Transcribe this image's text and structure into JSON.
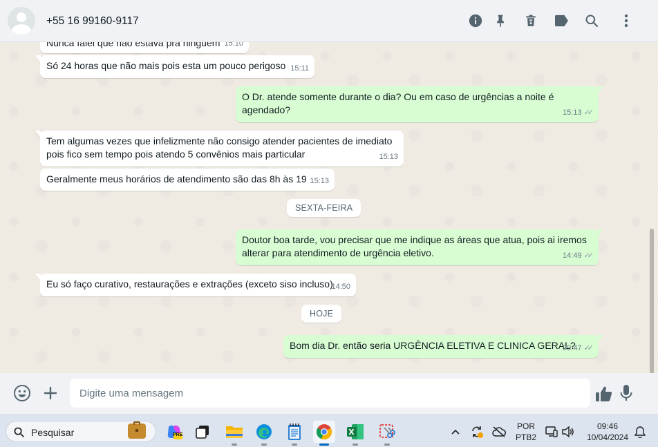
{
  "header": {
    "contact_name": "+55 16 99160-9117",
    "icons": [
      "info-icon",
      "pin-icon",
      "delete-icon",
      "label-icon",
      "search-icon",
      "menu-icon"
    ]
  },
  "messages": [
    {
      "dir": "in",
      "text": "Nunca falei que não estava pra ninguém",
      "time": "15:10"
    },
    {
      "dir": "in",
      "text": "Só 24 horas que não mais pois esta um pouco perigoso",
      "time": "15:11"
    },
    {
      "dir": "out",
      "line1": "O Dr. atende somente durante o dia? Ou em caso de urgências a noite é",
      "line2": "agendado?",
      "time": "15:13"
    },
    {
      "dir": "in",
      "line1": "Tem algumas vezes que infelizmente não consigo atender pacientes de imediato",
      "line2": "pois fico sem tempo pois atendo 5 convênios mais particular",
      "time": "15:13"
    },
    {
      "dir": "in",
      "text": "Geralmente meus horários de atendimento são das 8h às 19",
      "time": "15:13"
    },
    {
      "dir": "out",
      "line1": "Doutor boa tarde, vou precisar que me indique as áreas que atua, pois ai iremos",
      "line2": "alterar para atendimento de urgência eletivo.",
      "time": "14:49"
    },
    {
      "dir": "in",
      "text": "Eu só faço curativo, restaurações e extrações (exceto siso incluso)",
      "time": "14:50"
    },
    {
      "dir": "out",
      "text": "Bom dia Dr. então seria URGÊNCIA ELETIVA E CLINICA GERAL?",
      "time": "09:47"
    }
  ],
  "date_chips": [
    "SEXTA-FEIRA",
    "HOJE"
  ],
  "composer": {
    "placeholder": "Digite uma mensagem"
  },
  "taskbar": {
    "search_label": "Pesquisar",
    "lang_top": "POR",
    "lang_bottom": "PTB2",
    "time": "09:46",
    "date": "10/04/2024",
    "copilot_badge": "PRE"
  },
  "colors": {
    "incoming": "#ffffff",
    "outgoing": "#d9fdd3",
    "chat_bg": "#efeae2",
    "header_bg": "#f0f2f5",
    "taskbar_bg": "#dce4ef"
  }
}
